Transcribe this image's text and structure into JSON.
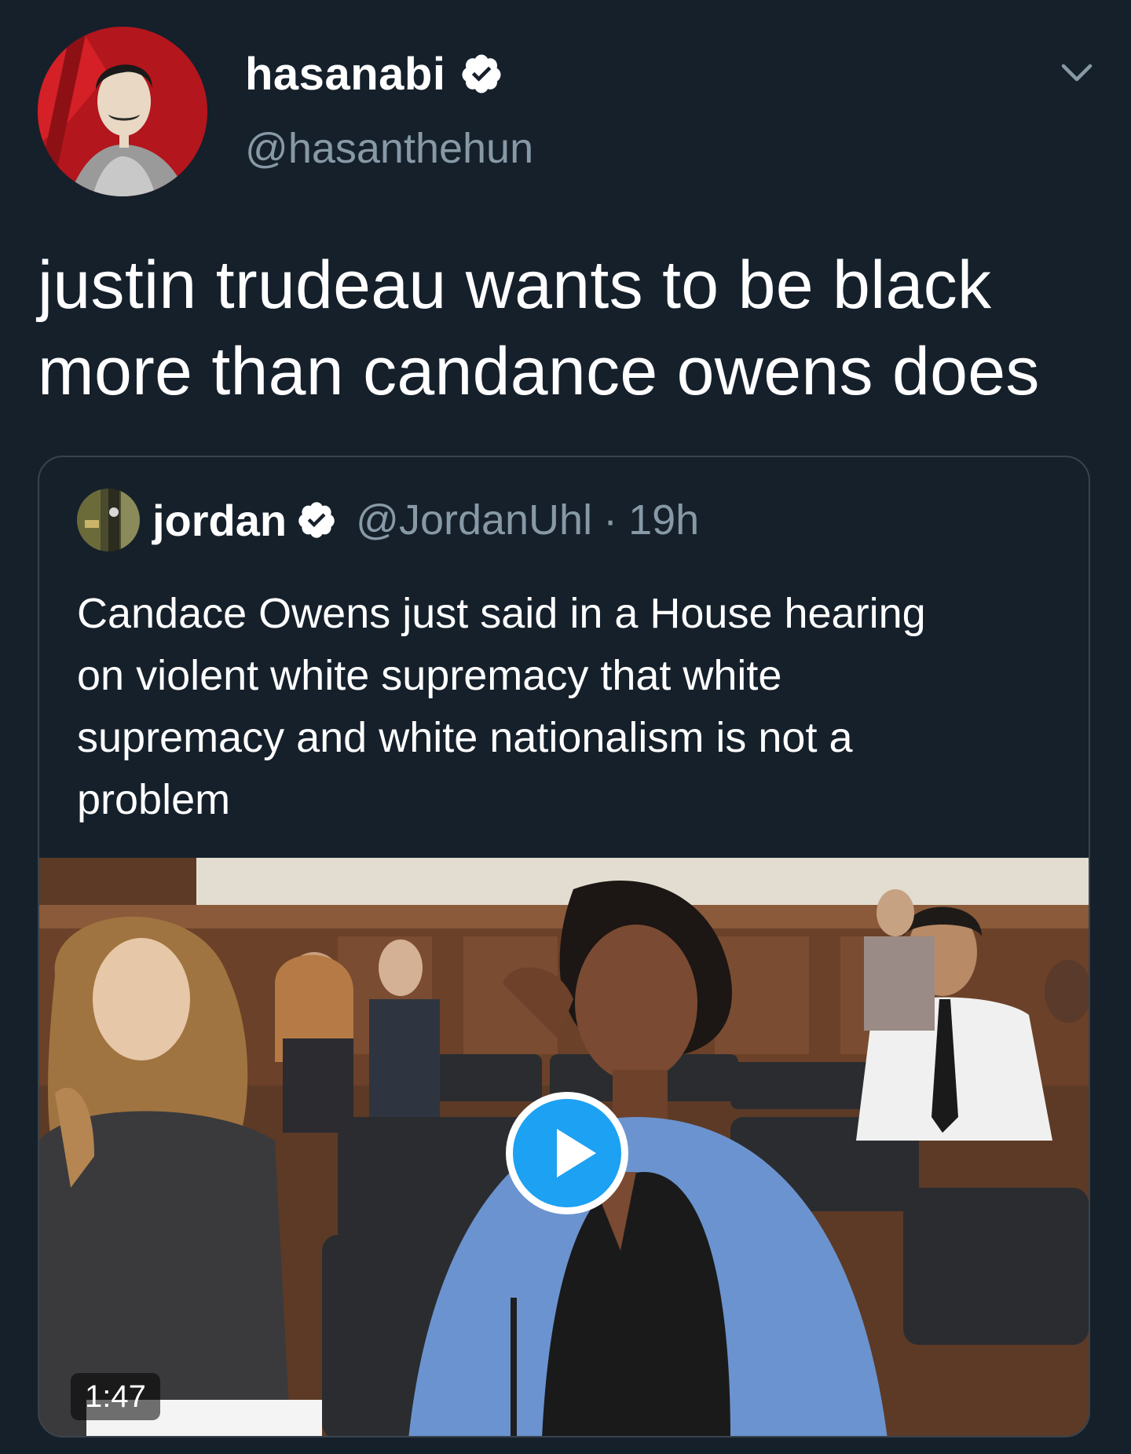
{
  "author": {
    "display_name": "hasanabi",
    "handle": "@hasanthehun",
    "verified": true,
    "avatar_icon": "avatar-illustration"
  },
  "tweet": {
    "lines": [
      "justin trudeau wants to be black",
      "more than candance owens does"
    ]
  },
  "menu_icon": "chevron-down-icon",
  "quoted_tweet": {
    "display_name": "jordan",
    "handle": "@JordanUhl",
    "separator": "·",
    "time": "19h",
    "verified": true,
    "lines": [
      "Candace Owens just said in a House hearing",
      "on violent white supremacy that white",
      "supremacy and white nationalism is not a",
      "problem"
    ],
    "media": {
      "type": "video",
      "duration": "1:47",
      "play_icon": "play-icon"
    }
  },
  "colors": {
    "background": "#15202b",
    "text_primary": "#ffffff",
    "text_secondary": "#8899a6",
    "accent": "#1da1f2",
    "border": "#38444d"
  }
}
